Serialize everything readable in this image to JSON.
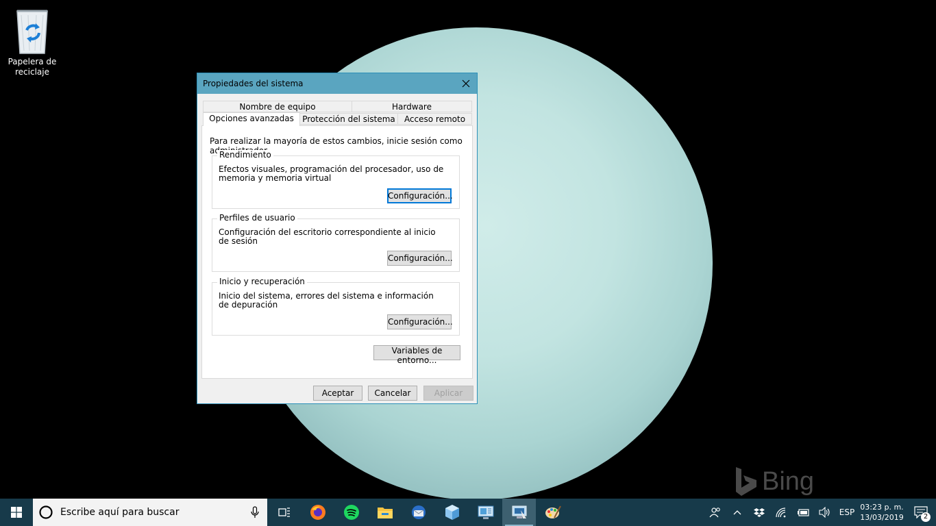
{
  "desktop": {
    "recycle_bin_label_line1": "Papelera de",
    "recycle_bin_label_line2": "reciclaje",
    "wallpaper_brand": "Bing"
  },
  "dialog": {
    "title": "Propiedades del sistema",
    "tabs_row1": [
      "Nombre de equipo",
      "Hardware"
    ],
    "tabs_row2": [
      "Opciones avanzadas",
      "Protección del sistema",
      "Acceso remoto"
    ],
    "active_tab": "Opciones avanzadas",
    "note": "Para realizar la mayoría de estos cambios, inicie sesión como administrador.",
    "performance": {
      "title": "Rendimiento",
      "desc": "Efectos visuales, programación del procesador, uso de memoria y memoria virtual",
      "button": "Configuración..."
    },
    "profiles": {
      "title": "Perfiles de usuario",
      "desc": "Configuración del escritorio correspondiente al inicio de sesión",
      "button": "Configuración..."
    },
    "startup": {
      "title": "Inicio y recuperación",
      "desc": "Inicio del sistema, errores del sistema e información de depuración",
      "button": "Configuración..."
    },
    "env_button": "Variables de entorno...",
    "ok": "Aceptar",
    "cancel": "Cancelar",
    "apply": "Aplicar"
  },
  "taskbar": {
    "search_placeholder": "Escribe aquí para buscar",
    "apps": [
      "firefox-icon",
      "spotify-icon",
      "file-explorer-icon",
      "thunderbird-icon",
      "virtualbox-icon",
      "control-panel-icon",
      "system-properties-icon",
      "paint-icon"
    ],
    "language": "ESP",
    "time": "03:23 p. m.",
    "date": "13/03/2019",
    "notification_count": "2"
  },
  "colors": {
    "titlebar": "#5aa5c0",
    "taskbar": "#173a4a",
    "focus_border": "#0078d7"
  }
}
